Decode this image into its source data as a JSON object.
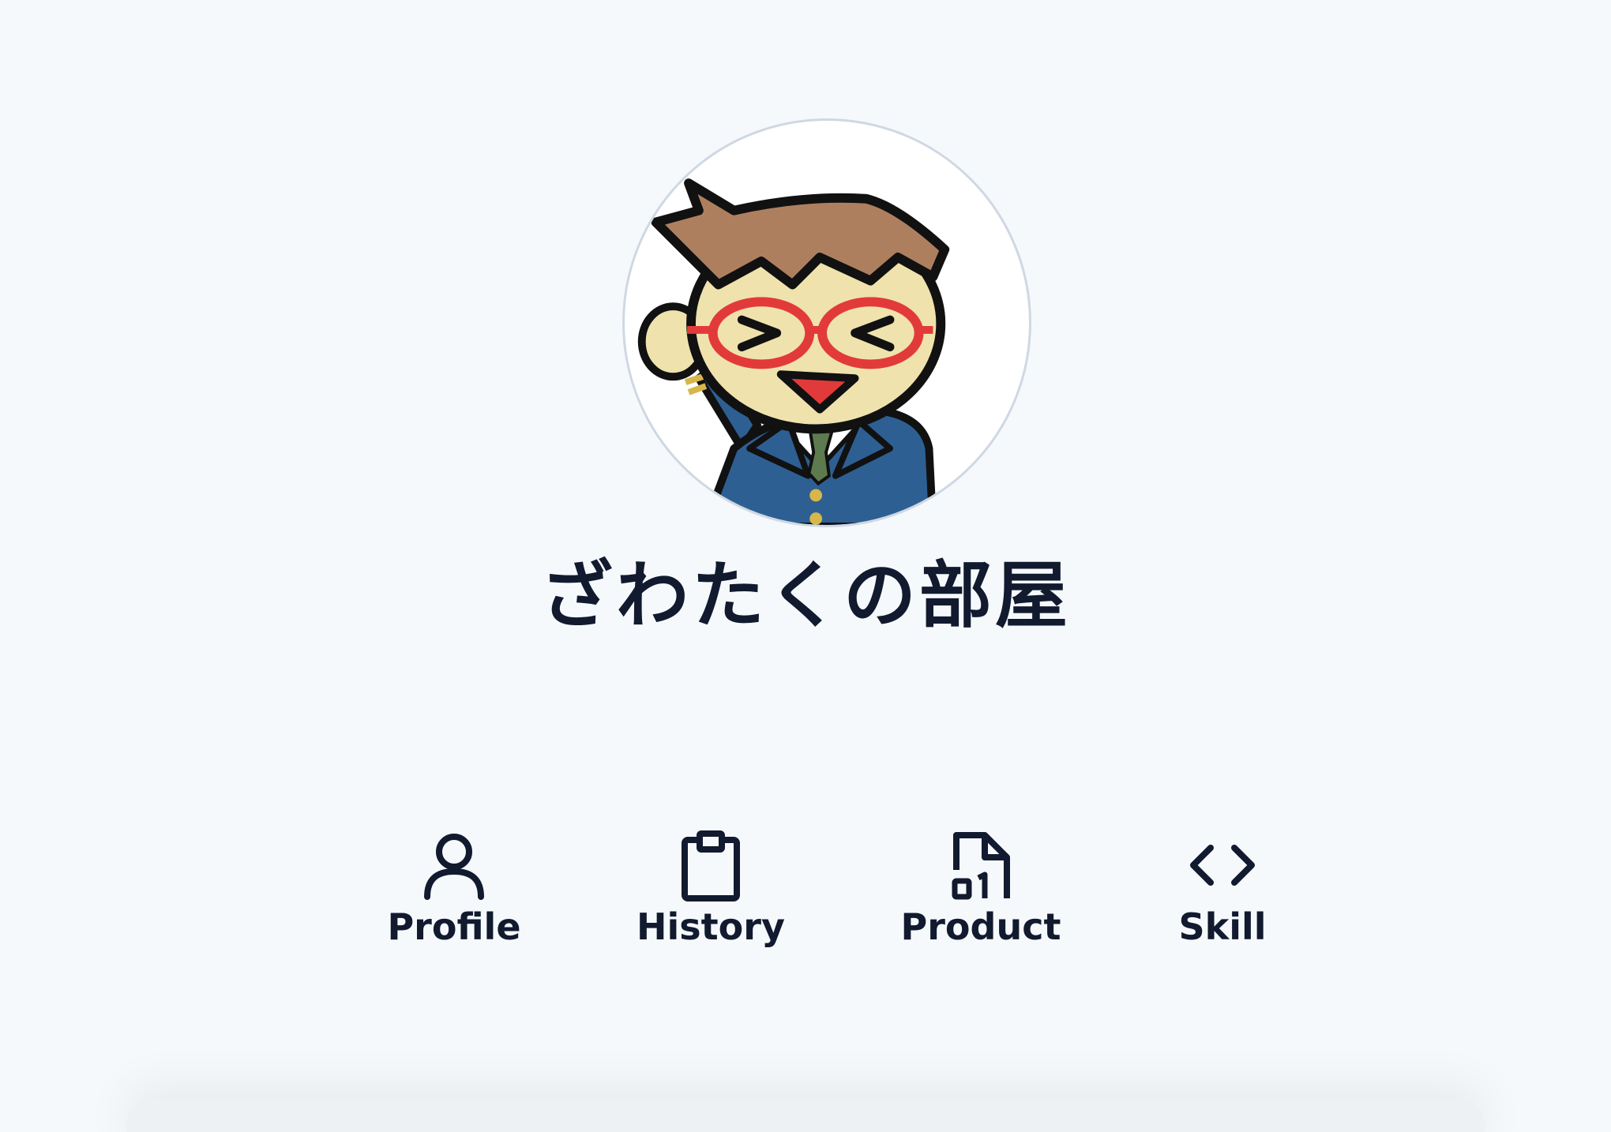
{
  "header": {
    "title": "ざわたくの部屋",
    "avatar_icon": "cartoon-avatar-icon"
  },
  "nav": {
    "items": [
      {
        "label": "Profile",
        "icon": "user-icon"
      },
      {
        "label": "History",
        "icon": "clipboard-icon"
      },
      {
        "label": "Product",
        "icon": "file-binary-icon"
      },
      {
        "label": "Skill",
        "icon": "code-icon"
      }
    ]
  },
  "colors": {
    "background": "#f6f9fc",
    "text": "#111a2e",
    "avatar_border": "#cfd8e3"
  }
}
